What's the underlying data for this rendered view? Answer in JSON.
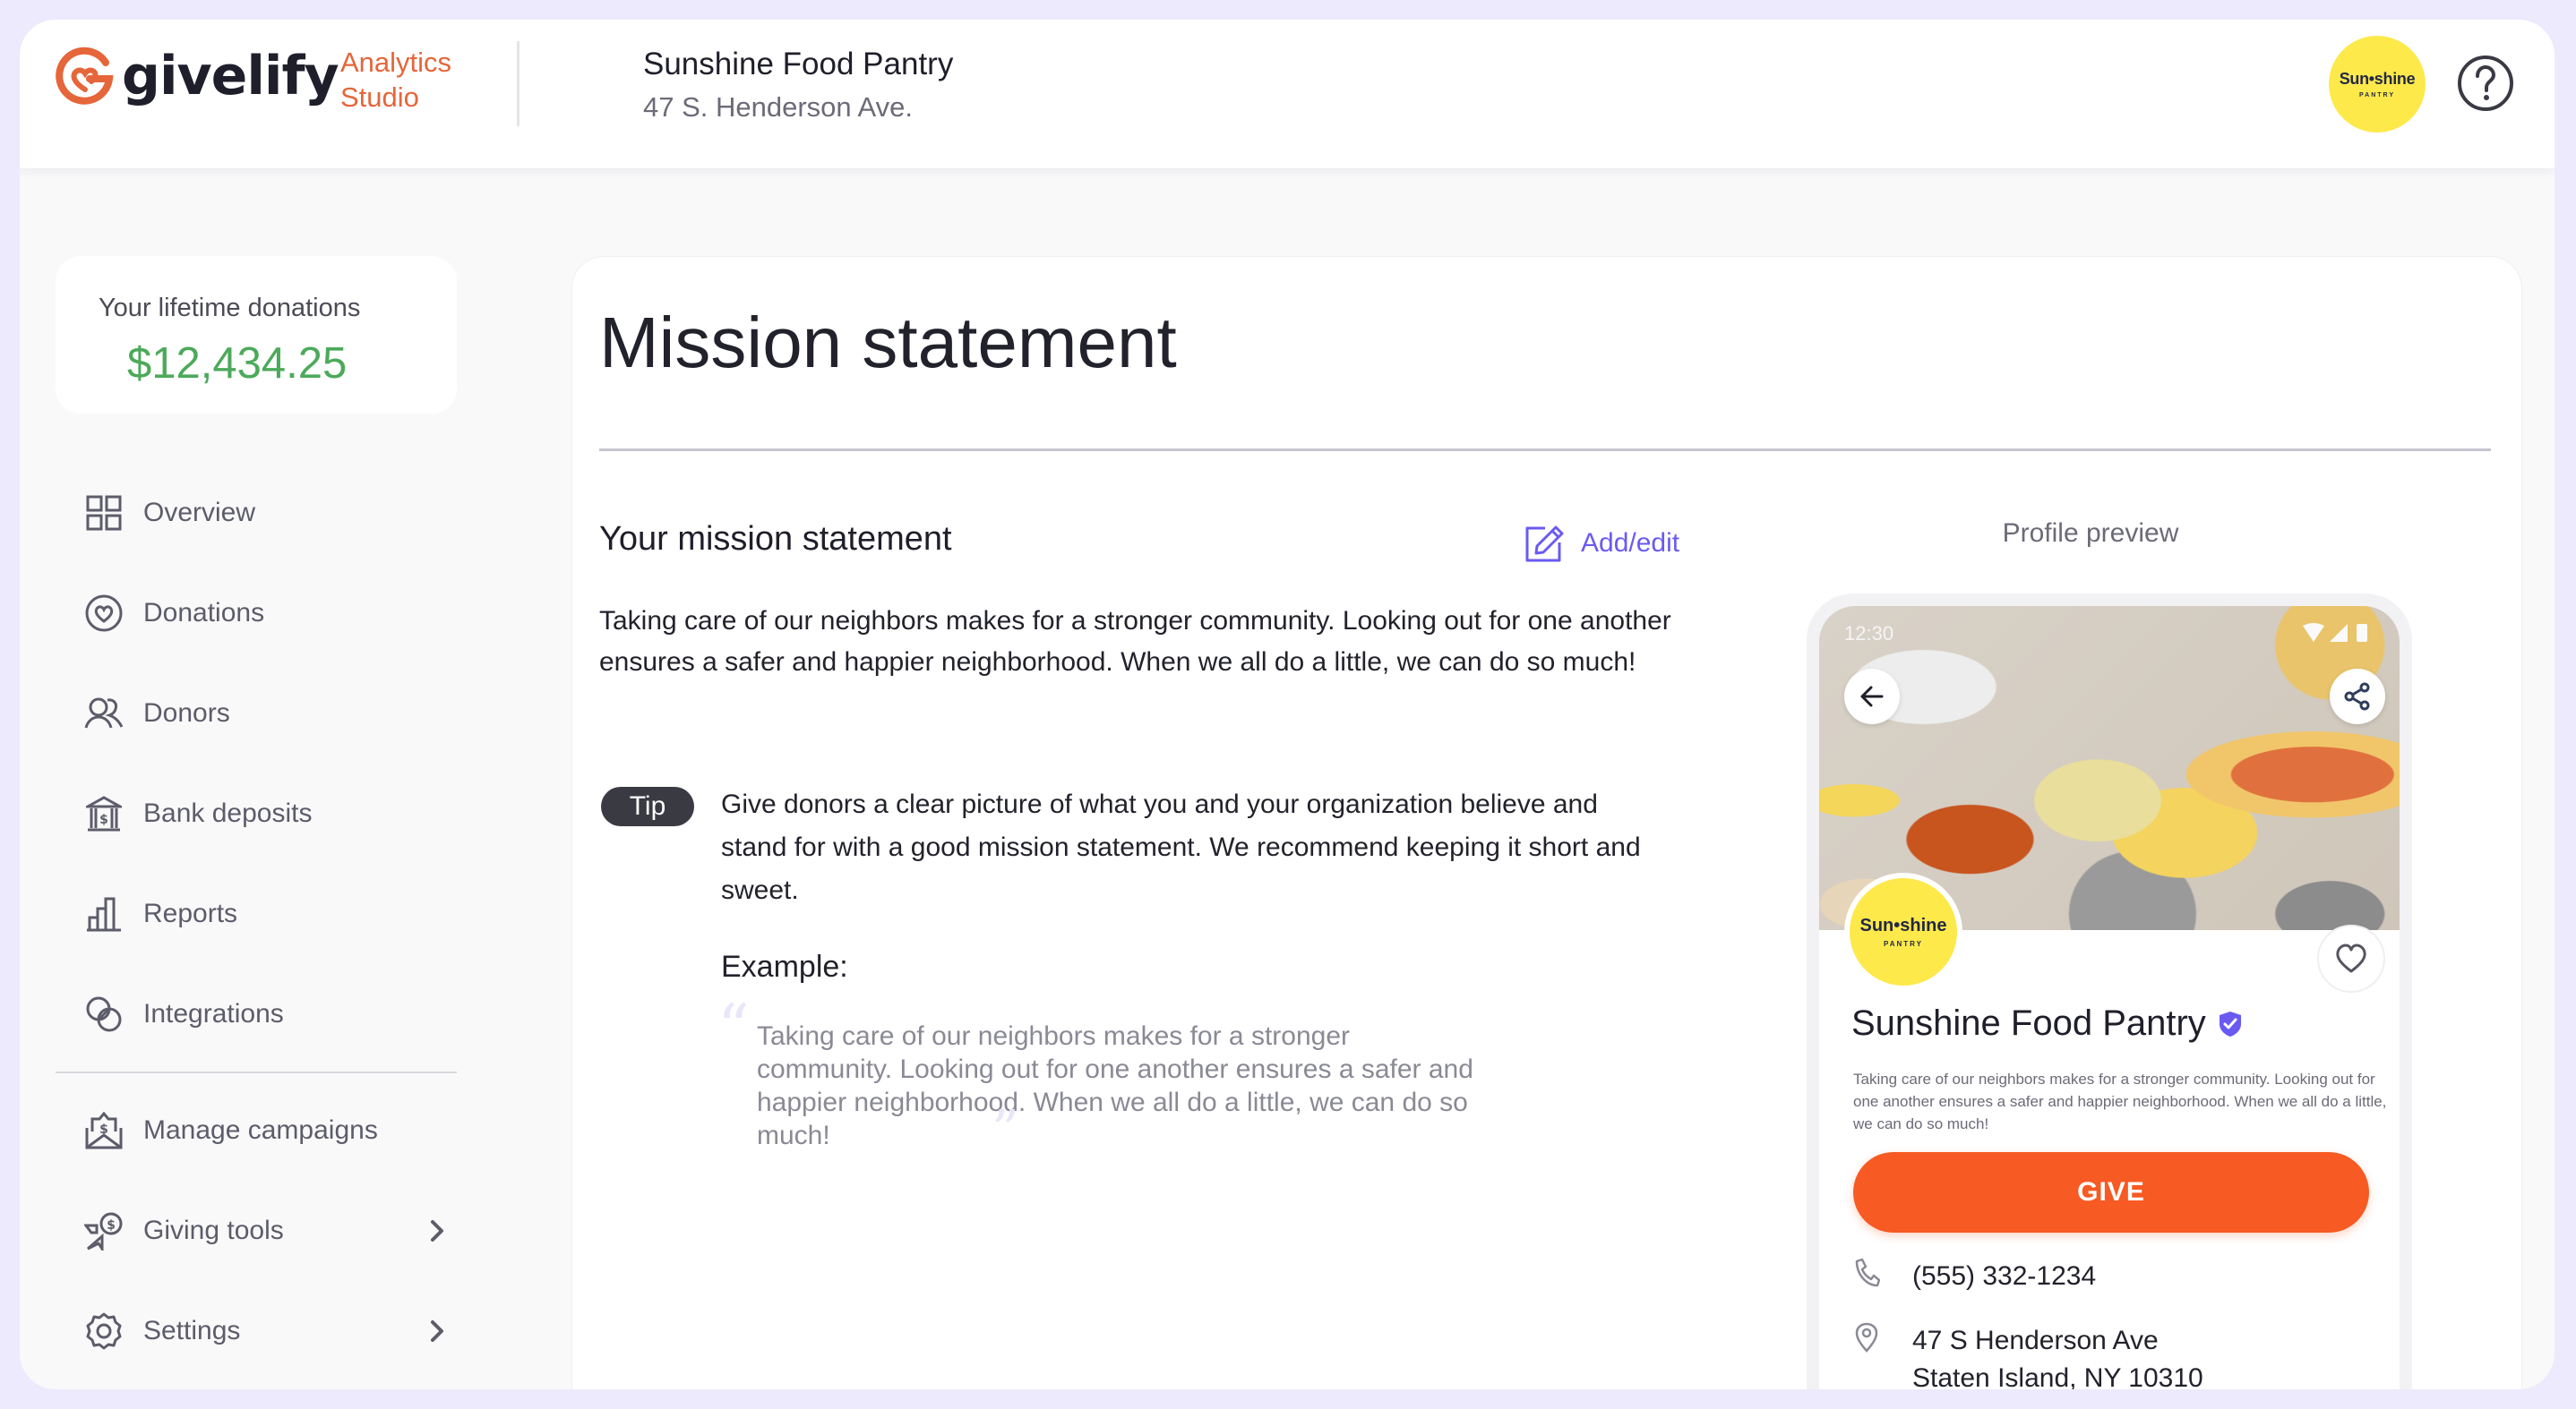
{
  "header": {
    "brand": "givelify",
    "product_line1": "Analytics",
    "product_line2": "Studio",
    "org_name": "Sunshine Food Pantry",
    "org_address": "47 S. Henderson Ave.",
    "avatar_line1": "Sun•shine",
    "avatar_line2": "PANTRY",
    "help_icon": "help-circle-icon"
  },
  "sidebar": {
    "lifetime_label": "Your lifetime donations",
    "lifetime_value": "$12,434.25",
    "items": [
      {
        "label": "Overview",
        "icon": "grid-icon"
      },
      {
        "label": "Donations",
        "icon": "heart-circle-icon"
      },
      {
        "label": "Donors",
        "icon": "users-icon"
      },
      {
        "label": "Bank deposits",
        "icon": "bank-icon"
      },
      {
        "label": "Reports",
        "icon": "bar-chart-icon"
      },
      {
        "label": "Integrations",
        "icon": "integrations-icon"
      },
      {
        "label": "Manage campaigns",
        "icon": "envelope-dollar-icon"
      },
      {
        "label": "Giving tools",
        "icon": "giving-tools-icon",
        "has_submenu": true
      },
      {
        "label": "Settings",
        "icon": "gear-icon",
        "has_submenu": true
      }
    ]
  },
  "main": {
    "title": "Mission statement",
    "section_title": "Your mission statement",
    "add_edit_label": "Add/edit",
    "mission_text": "Taking care of our neighbors makes for a stronger community. Looking out for one another ensures a safer and happier neighborhood. When we all do a little, we can do so much!",
    "tip_badge": "Tip",
    "tip_text": "Give donors a clear picture of what you and your organization believe and stand for with a good mission statement. We recommend keeping it short and sweet.",
    "example_label": "Example:",
    "example_text": "Taking care of our neighbors makes for a stronger community. Looking out for one another ensures a safer and happier neighborhood. When we all do a little, we can do so much!",
    "quote_open": "“",
    "quote_close": "”",
    "preview_label": "Profile preview"
  },
  "phone": {
    "status_time": "12:30",
    "org_logo_line1": "Sun•shine",
    "org_logo_line2": "PANTRY",
    "org_name": "Sunshine Food Pantry",
    "verified": true,
    "description": "Taking care of our neighbors makes for a stronger community. Looking out for one another ensures a safer and happier neighborhood. When we all do a little, we can do so much!",
    "give_label": "GIVE",
    "phone_number": "(555) 332-1234",
    "address_line1": "47 S Henderson Ave",
    "address_line2": "Staten Island, NY 10310"
  },
  "colors": {
    "brand_orange": "#E5663A",
    "give_orange": "#F75A22",
    "accent_purple": "#6A5AF2",
    "donation_green": "#4CAA5A",
    "avatar_yellow": "#FDE94A",
    "outer_background": "#ECEAFC"
  }
}
